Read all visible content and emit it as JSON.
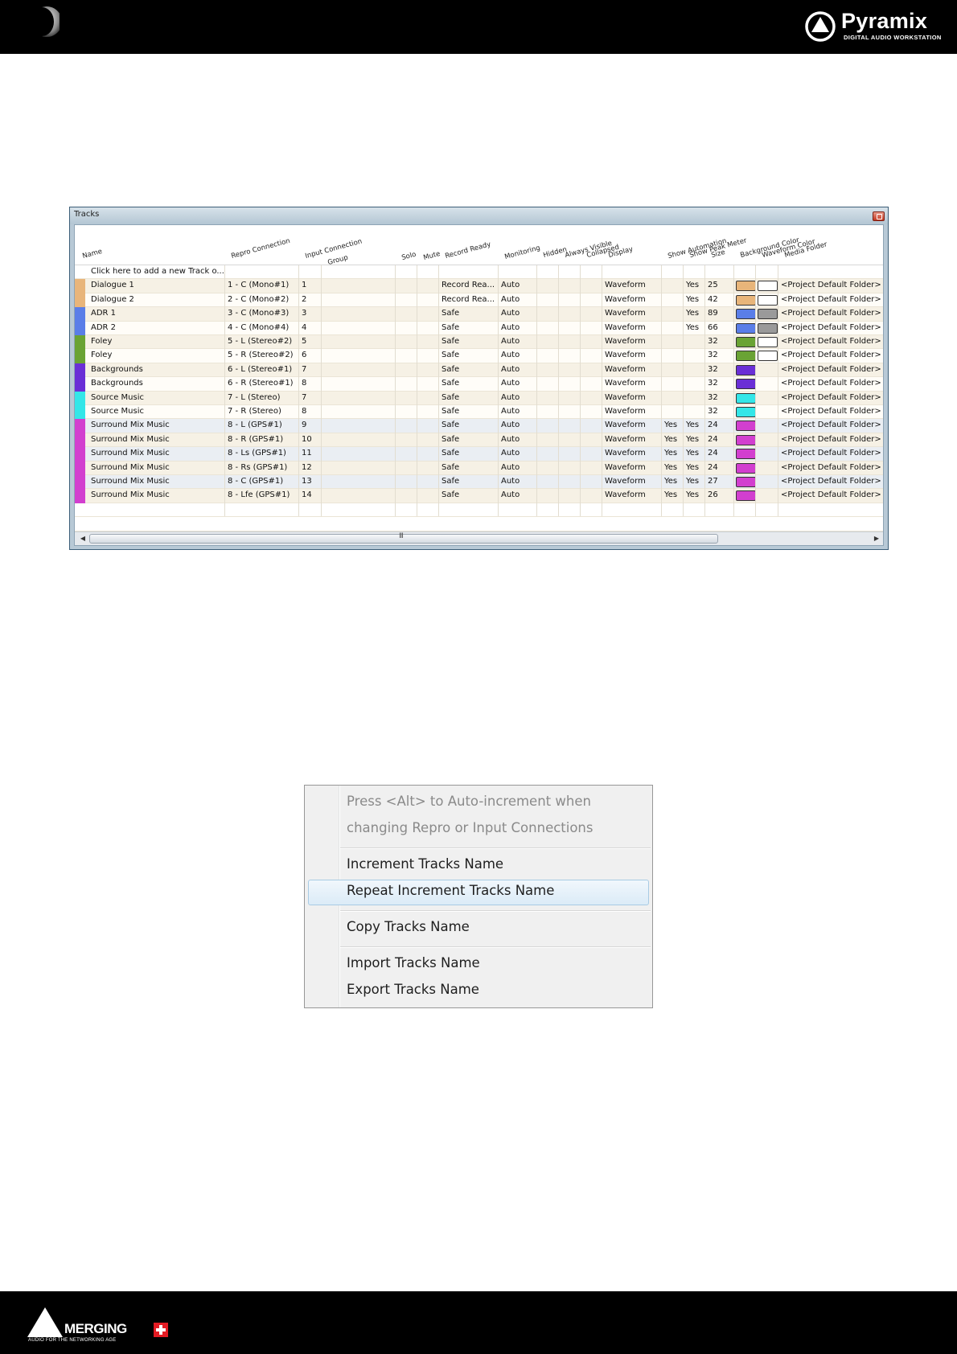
{
  "header": {
    "brand_name": "Pyramix",
    "brand_tagline": "DIGITAL AUDIO WORKSTATION"
  },
  "tracks_window": {
    "title": "Tracks",
    "columns": {
      "name": "Name",
      "repro": "Repro Connection",
      "input": "Input Connection",
      "group": "Group",
      "solo": "Solo",
      "mute": "Mute",
      "record_ready": "Record Ready",
      "monitoring": "Monitoring",
      "hidden": "Hidden",
      "always_visible": "Always Visible",
      "collapsed": "Collapsed",
      "display": "Display",
      "show_automation": "Show Automation",
      "show_peak_meter": "Show Peak Meter",
      "size": "Size",
      "background_color": "Background Color",
      "waveform_color": "Waveform Color",
      "media_folder": "Media Folder"
    },
    "add_row_text": "Click here to add a new Track o...",
    "rows": [
      {
        "name": "Dialogue 1",
        "repro": "1 - C (Mono#1)",
        "input": "1",
        "record": "Record Rea...",
        "monitoring": "Auto",
        "display": "Waveform",
        "automation": "",
        "peak": "Yes",
        "size": "25",
        "bg": "#e8b57a",
        "wave": "#ffffff",
        "stripe": "#e8b57a",
        "folder": "<Project Default Folder>"
      },
      {
        "name": "Dialogue 2",
        "repro": "2 - C (Mono#2)",
        "input": "2",
        "record": "Record Rea...",
        "monitoring": "Auto",
        "display": "Waveform",
        "automation": "",
        "peak": "Yes",
        "size": "42",
        "bg": "#e8b57a",
        "wave": "#ffffff",
        "stripe": "#e8b57a",
        "folder": "<Project Default Folder>"
      },
      {
        "name": "ADR 1",
        "repro": "3 - C (Mono#3)",
        "input": "3",
        "record": "Safe",
        "monitoring": "Auto",
        "display": "Waveform",
        "automation": "",
        "peak": "Yes",
        "size": "89",
        "bg": "#5a7ee8",
        "wave": "#9a9a9a",
        "stripe": "#5a7ee8",
        "folder": "<Project Default Folder>"
      },
      {
        "name": "ADR 2",
        "repro": "4 - C (Mono#4)",
        "input": "4",
        "record": "Safe",
        "monitoring": "Auto",
        "display": "Waveform",
        "automation": "",
        "peak": "Yes",
        "size": "66",
        "bg": "#5a7ee8",
        "wave": "#9a9a9a",
        "stripe": "#5a7ee8",
        "folder": "<Project Default Folder>"
      },
      {
        "name": "Foley",
        "repro": "5 - L (Stereo#2)",
        "input": "5",
        "record": "Safe",
        "monitoring": "Auto",
        "display": "Waveform",
        "automation": "",
        "peak": "",
        "size": "32",
        "bg": "#6aa334",
        "wave": "#ffffff",
        "stripe": "#6aa334",
        "folder": "<Project Default Folder>"
      },
      {
        "name": "Foley",
        "repro": "5 - R (Stereo#2)",
        "input": "6",
        "record": "Safe",
        "monitoring": "Auto",
        "display": "Waveform",
        "automation": "",
        "peak": "",
        "size": "32",
        "bg": "#6aa334",
        "wave": "#ffffff",
        "stripe": "#6aa334",
        "folder": "<Project Default Folder>"
      },
      {
        "name": "Backgrounds",
        "repro": "6 - L (Stereo#1)",
        "input": "7",
        "record": "Safe",
        "monitoring": "Auto",
        "display": "Waveform",
        "automation": "",
        "peak": "",
        "size": "32",
        "bg": "#6a2fd6",
        "wave": "",
        "stripe": "#6a2fd6",
        "folder": "<Project Default Folder>"
      },
      {
        "name": "Backgrounds",
        "repro": "6 - R (Stereo#1)",
        "input": "8",
        "record": "Safe",
        "monitoring": "Auto",
        "display": "Waveform",
        "automation": "",
        "peak": "",
        "size": "32",
        "bg": "#6a2fd6",
        "wave": "",
        "stripe": "#6a2fd6",
        "folder": "<Project Default Folder>"
      },
      {
        "name": "Source Music",
        "repro": "7 - L (Stereo)",
        "input": "7",
        "record": "Safe",
        "monitoring": "Auto",
        "display": "Waveform",
        "automation": "",
        "peak": "",
        "size": "32",
        "bg": "#34e6e8",
        "wave": "",
        "stripe": "#34e6e8",
        "folder": "<Project Default Folder>"
      },
      {
        "name": "Source Music",
        "repro": "7 - R (Stereo)",
        "input": "8",
        "record": "Safe",
        "monitoring": "Auto",
        "display": "Waveform",
        "automation": "",
        "peak": "",
        "size": "32",
        "bg": "#34e6e8",
        "wave": "",
        "stripe": "#34e6e8",
        "folder": "<Project Default Folder>"
      },
      {
        "name": "Surround Mix Music",
        "repro": "8 - L (GPS#1)",
        "input": "9",
        "record": "Safe",
        "monitoring": "Auto",
        "display": "Waveform",
        "automation": "Yes",
        "peak": "Yes",
        "size": "24",
        "bg": "#d23fcf",
        "wave": "",
        "stripe": "#d23fcf",
        "folder": "<Project Default Folder>"
      },
      {
        "name": "Surround Mix Music",
        "repro": "8 - R (GPS#1)",
        "input": "10",
        "record": "Safe",
        "monitoring": "Auto",
        "display": "Waveform",
        "automation": "Yes",
        "peak": "Yes",
        "size": "24",
        "bg": "#d23fcf",
        "wave": "",
        "stripe": "#d23fcf",
        "folder": "<Project Default Folder>"
      },
      {
        "name": "Surround Mix Music",
        "repro": "8 - Ls (GPS#1)",
        "input": "11",
        "record": "Safe",
        "monitoring": "Auto",
        "display": "Waveform",
        "automation": "Yes",
        "peak": "Yes",
        "size": "24",
        "bg": "#d23fcf",
        "wave": "",
        "stripe": "#d23fcf",
        "folder": "<Project Default Folder>"
      },
      {
        "name": "Surround Mix Music",
        "repro": "8 - Rs (GPS#1)",
        "input": "12",
        "record": "Safe",
        "monitoring": "Auto",
        "display": "Waveform",
        "automation": "Yes",
        "peak": "Yes",
        "size": "24",
        "bg": "#d23fcf",
        "wave": "",
        "stripe": "#d23fcf",
        "folder": "<Project Default Folder>"
      },
      {
        "name": "Surround Mix Music",
        "repro": "8 - C (GPS#1)",
        "input": "13",
        "record": "Safe",
        "monitoring": "Auto",
        "display": "Waveform",
        "automation": "Yes",
        "peak": "Yes",
        "size": "27",
        "bg": "#d23fcf",
        "wave": "",
        "stripe": "#d23fcf",
        "folder": "<Project Default Folder>"
      },
      {
        "name": "Surround Mix Music",
        "repro": "8 - Lfe (GPS#1)",
        "input": "14",
        "record": "Safe",
        "monitoring": "Auto",
        "display": "Waveform",
        "automation": "Yes",
        "peak": "Yes",
        "size": "26",
        "bg": "#d23fcf",
        "wave": "",
        "stripe": "#d23fcf",
        "folder": "<Project Default Folder>"
      }
    ],
    "scroll_grip": "III"
  },
  "context_menu": {
    "hint_line1": "Press <Alt> to Auto-increment when",
    "hint_line2": "changing Repro or Input Connections",
    "increment": "Increment Tracks Name",
    "repeat_increment": "Repeat  Increment Tracks Name",
    "copy": "Copy Tracks Name",
    "import": "Import Tracks Name",
    "export": "Export Tracks Name"
  },
  "footer": {
    "brand_name": "MERGING",
    "brand_tagline": "AUDIO FOR THE NETWORKING AGE"
  }
}
